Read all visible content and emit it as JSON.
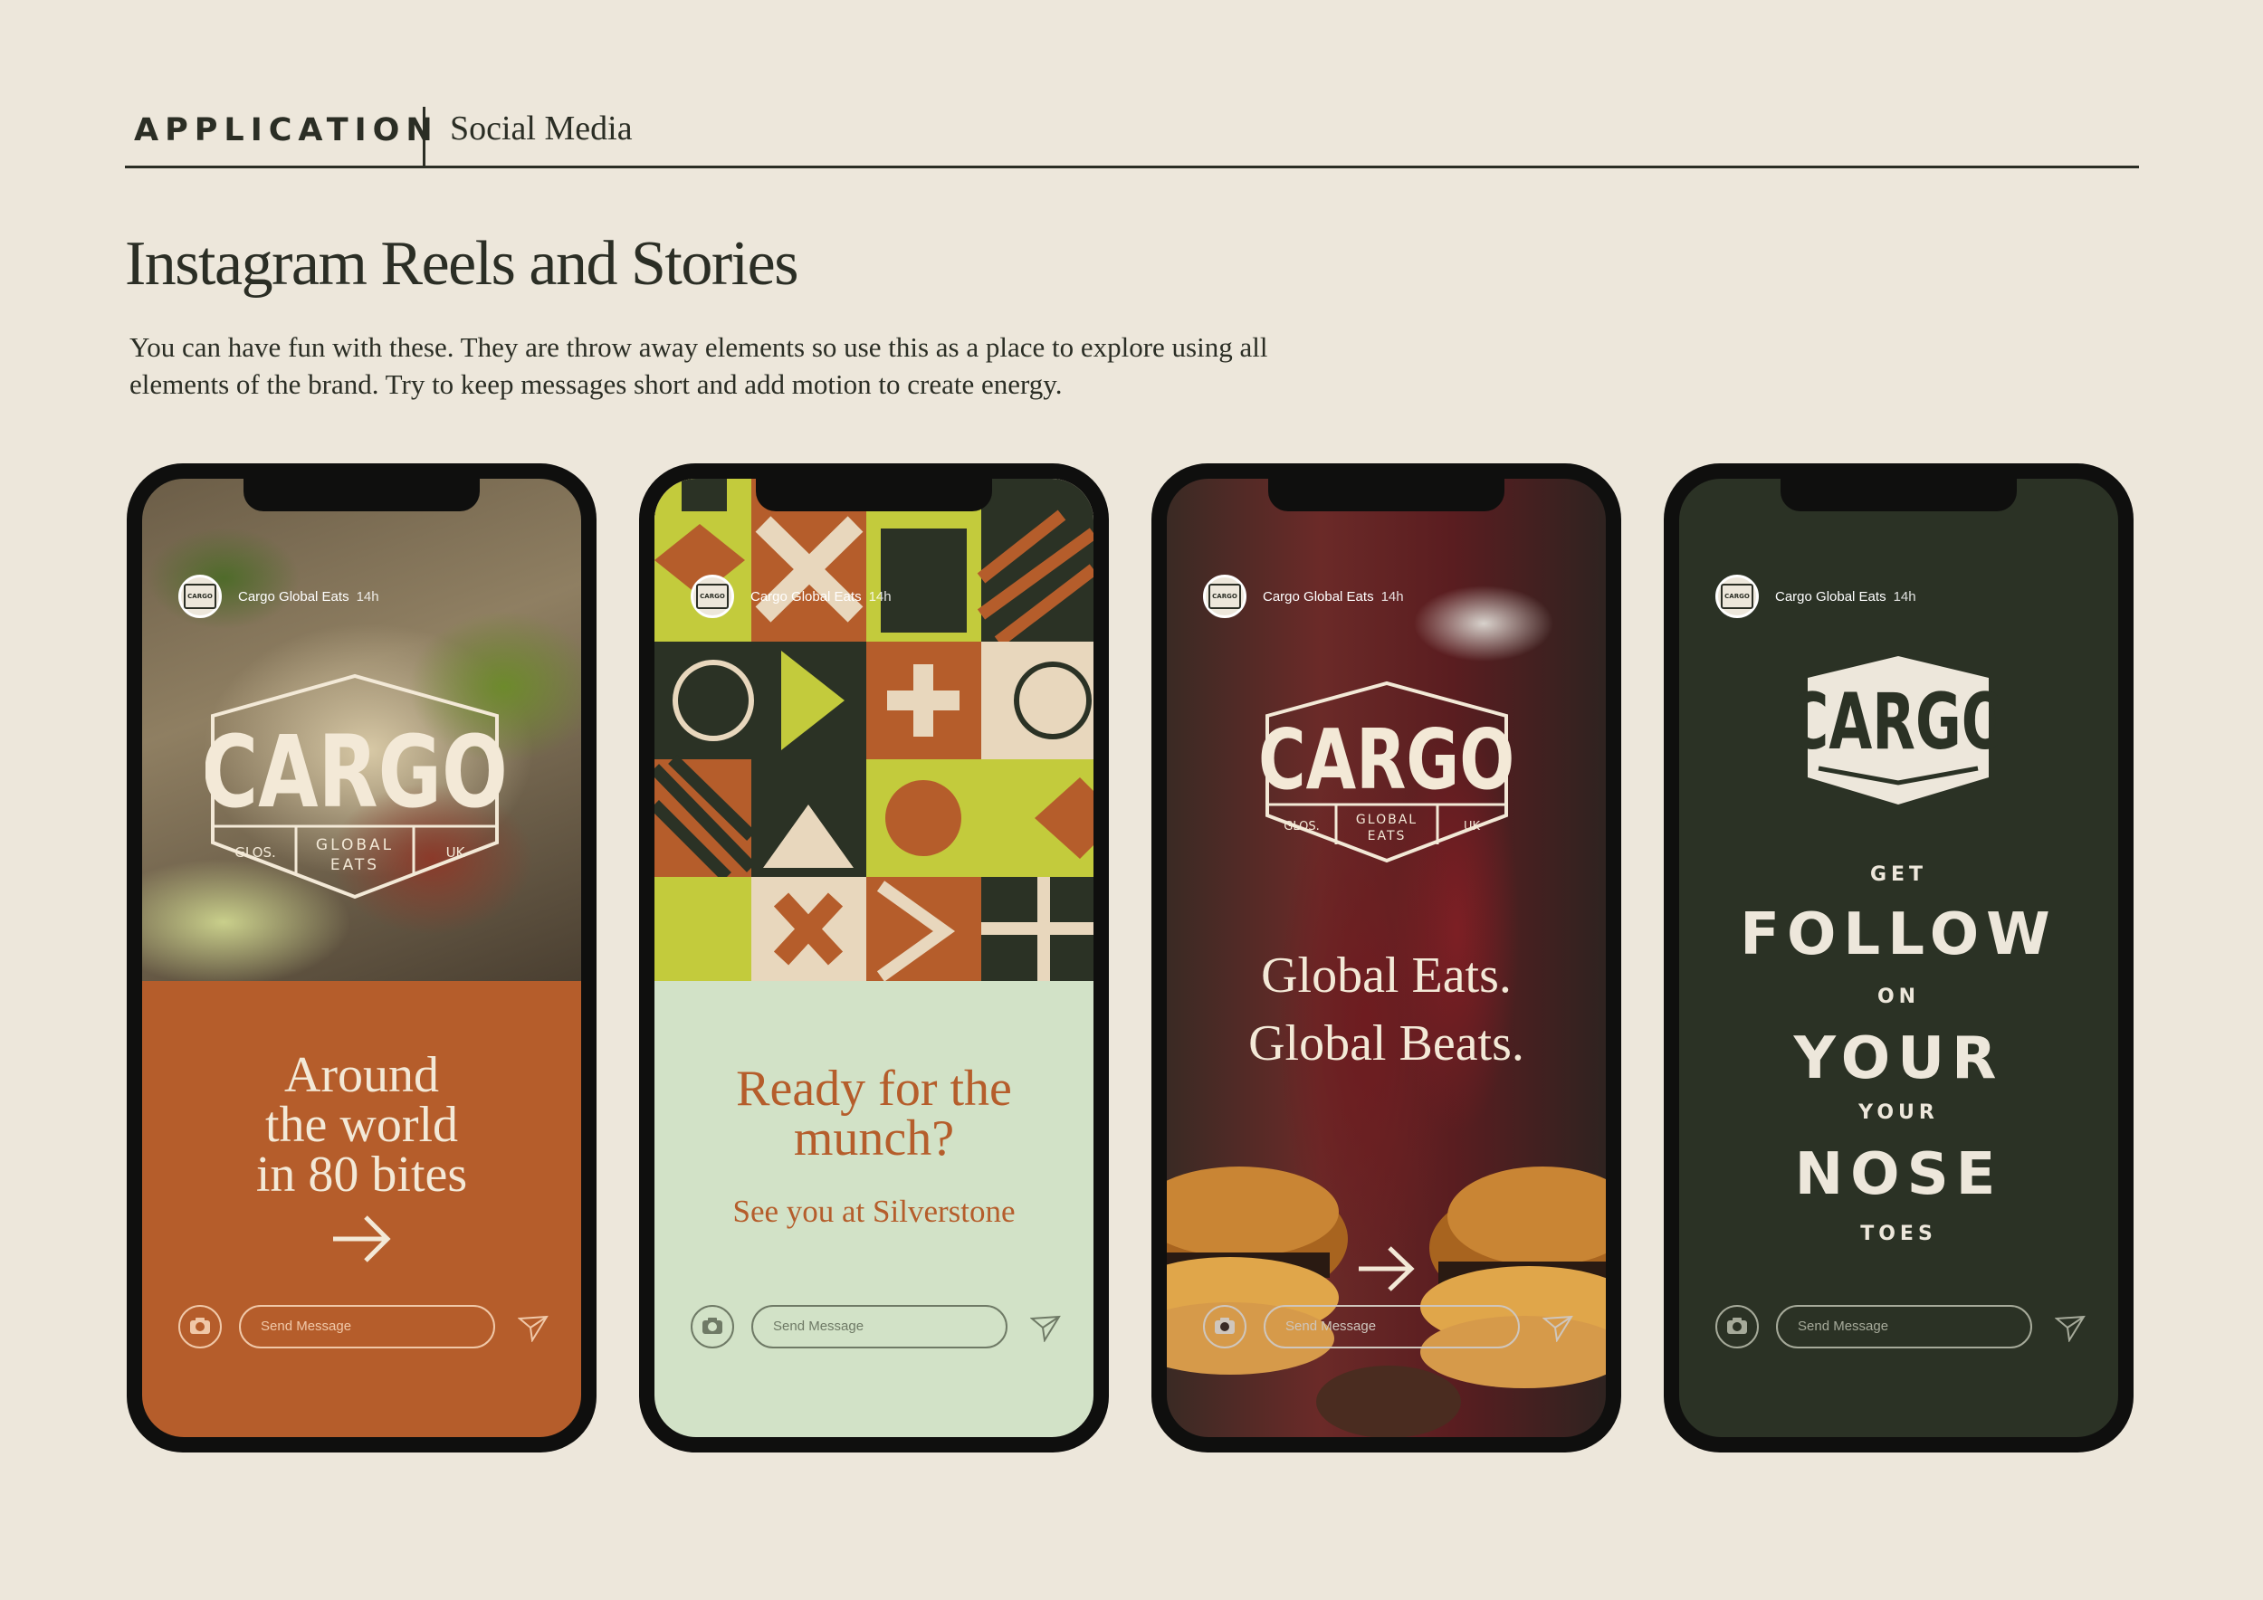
{
  "colors": {
    "page_bg": "#ede7db",
    "ink": "#2b2e25",
    "rust": "#b55d2b",
    "sage": "#d2e2c7",
    "dark_green": "#2b3225",
    "cream": "#f3e9d7",
    "lime": "#c3cb3c"
  },
  "header": {
    "section": "APPLICATION",
    "subsection": "Social Media"
  },
  "page": {
    "title": "Instagram Reels and Stories",
    "description": "You can have fun with these. They are throw away elements so use this as a place to explore using all elements of the brand. Try to keep messages short and add motion to create energy."
  },
  "logo": {
    "wordmark": "CARGO",
    "left": "GLOS.",
    "middle_1": "GLOBAL",
    "middle_2": "EATS",
    "right": "UK"
  },
  "story_ui": {
    "account": "Cargo Global Eats",
    "age": "14h",
    "message_placeholder": "Send Message",
    "camera_icon": "camera-icon",
    "send_icon": "send-icon"
  },
  "stories": [
    {
      "headline_lines": [
        "Around",
        "the world",
        "in 80 bites"
      ],
      "icon": "arrow-right-icon"
    },
    {
      "headline_lines": [
        "Ready for the",
        "munch?"
      ],
      "subline": "See you at Silverstone"
    },
    {
      "headline_lines": [
        "Global Eats.",
        "Global Beats."
      ],
      "icon": "arrow-right-icon"
    },
    {
      "lines": [
        "GET",
        "FOLLOW",
        "ON",
        "YOUR",
        "YOUR",
        "NOSE",
        "TOES"
      ]
    }
  ]
}
